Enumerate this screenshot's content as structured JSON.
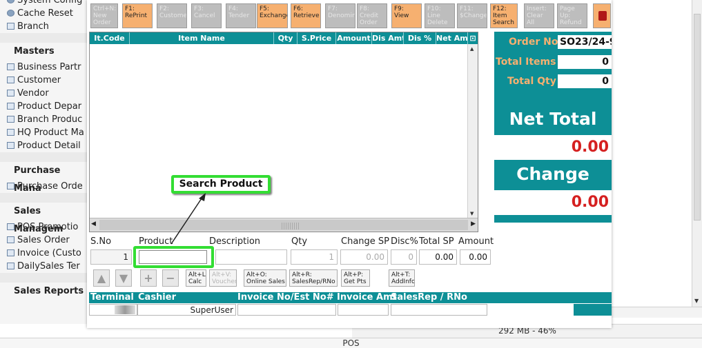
{
  "sidebar": {
    "top_items": [
      {
        "label": "System Config",
        "icon": "gear-icon"
      },
      {
        "label": "Cache Reset",
        "icon": "gear-icon"
      },
      {
        "label": "Branch",
        "icon": "window-icon"
      }
    ],
    "sections": [
      {
        "title": "Masters",
        "items": [
          "Business Partr",
          "Customer",
          "Vendor",
          "Product Depar",
          "Branch Produc",
          "HQ Product Ma",
          "Product Detail"
        ]
      },
      {
        "title": "Purchase Mana",
        "items": [
          "Purchase Orde"
        ]
      },
      {
        "title": "Sales Managem",
        "items": [
          "POS Promotio",
          "Sales Order",
          "Invoice (Custo",
          "DailySales Ter"
        ]
      },
      {
        "title": "Sales Reports",
        "items": []
      }
    ]
  },
  "fkeys": [
    {
      "key": "Ctrl+N:",
      "label": "New Order",
      "enabled": false
    },
    {
      "key": "F1:",
      "label": "RePrint",
      "enabled": true
    },
    {
      "key": "F2:",
      "label": "Customer",
      "enabled": false
    },
    {
      "key": "F3:",
      "label": "Cancel",
      "enabled": false
    },
    {
      "key": "F4:",
      "label": "Tender",
      "enabled": false
    },
    {
      "key": "F5:",
      "label": "Exchange",
      "enabled": true
    },
    {
      "key": "F6:",
      "label": "Retrieve",
      "enabled": true
    },
    {
      "key": "F7:",
      "label": "Denomination",
      "enabled": false
    },
    {
      "key": "F8:",
      "label": "Credit Order",
      "enabled": false
    },
    {
      "key": "F9:",
      "label": "View",
      "enabled": true
    },
    {
      "key": "F10:",
      "label": "Line Delete",
      "enabled": false
    },
    {
      "key": "F11:",
      "label": "$Change",
      "enabled": false
    },
    {
      "key": "F12:",
      "label": "Item Search",
      "enabled": true
    },
    {
      "key": "Insert:",
      "label": "Clear All",
      "enabled": false
    },
    {
      "key": "Page Up:",
      "label": "Refund",
      "enabled": false
    }
  ],
  "grid": {
    "columns": [
      "It.Code",
      "Item Name",
      "Qty",
      "S.Price",
      "Amount",
      "Dis Amt",
      "Dis %",
      "Net Amt"
    ]
  },
  "summary": {
    "order_no_label": "Order No",
    "order_no": "SO23/24-9",
    "total_items_label": "Total Items",
    "total_items": "0",
    "total_qty_label": "Total Qty",
    "total_qty": "0",
    "net_total_label": "Net Total",
    "net_total": "0.00",
    "change_label": "Change",
    "change": "0.00"
  },
  "entry": {
    "labels": [
      "S.No",
      "Product",
      "Description",
      "Qty",
      "Change SP",
      "Disc%",
      "Total SP",
      "Amount"
    ],
    "sno": "1",
    "product": "",
    "description": "",
    "qty": "1",
    "change_sp": "0.00",
    "disc": "0",
    "total_sp": "0.00",
    "amount": "0.00"
  },
  "shortcuts": [
    {
      "key": "Alt+L:",
      "label": "Calc",
      "enabled": true
    },
    {
      "key": "Alt+V:",
      "label": "Voucher",
      "enabled": false
    },
    {
      "key": "Alt+O:",
      "label": "Online Sales",
      "enabled": true
    },
    {
      "key": "Alt+R:",
      "label": "SalesRep/RNo",
      "enabled": true
    },
    {
      "key": "Alt+P:",
      "label": "Get Pts",
      "enabled": true
    },
    {
      "key": "Alt+T:",
      "label": "AddInfo",
      "enabled": true
    }
  ],
  "info": {
    "labels": [
      "Terminal",
      "Cashier",
      "Invoice No/Est No#",
      "Invoice Amt",
      "SalesRep / RNo"
    ],
    "cashier": "SuperUser"
  },
  "annotation": {
    "label": "Search Product"
  },
  "memory": "292 MB - 46%",
  "status": "POS",
  "colors": {
    "teal": "#0d8f96",
    "orange": "#f6b070",
    "red": "#d52020",
    "highlight": "#33dd33"
  }
}
